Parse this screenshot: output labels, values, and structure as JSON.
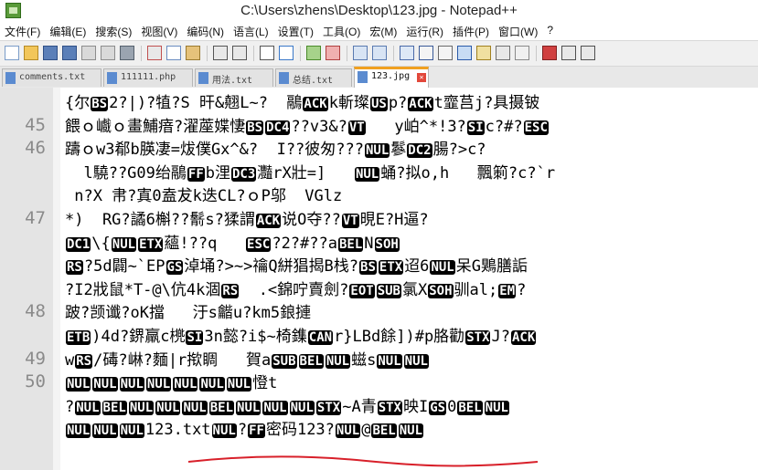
{
  "window": {
    "title": "C:\\Users\\zhens\\Desktop\\123.jpg - Notepad++"
  },
  "menu": {
    "items": [
      "文件(F)",
      "编辑(E)",
      "搜索(S)",
      "视图(V)",
      "编码(N)",
      "语言(L)",
      "设置(T)",
      "工具(O)",
      "宏(M)",
      "运行(R)",
      "插件(P)",
      "窗口(W)",
      "?"
    ]
  },
  "tabs": [
    {
      "label": "comments.txt"
    },
    {
      "label": "111111.php"
    },
    {
      "label": "用法.txt"
    },
    {
      "label": "总结.txt"
    },
    {
      "label": "123.jpg",
      "active": true
    }
  ],
  "editor": {
    "lines": [
      {
        "num": "",
        "segs": [
          [
            "t",
            "{尔"
          ],
          [
            "c",
            "BS"
          ],
          [
            "t",
            "2?|)?犆?S 旰&翹L~?  鷊"
          ],
          [
            "c",
            "ACK"
          ],
          [
            "t",
            "k斬璨"
          ],
          [
            "c",
            "US"
          ],
          [
            "t",
            "p?"
          ],
          [
            "c",
            "ACK"
          ],
          [
            "t",
            "t韲莒j?具摄铍"
          ]
        ]
      },
      {
        "num": "45",
        "segs": [
          [
            "t",
            "餵ｏ巇ｏ畫鯆瘖?濯蓙媟悽"
          ],
          [
            "c",
            "BS"
          ],
          [
            "c",
            "DC4"
          ],
          [
            "t",
            "??v3&?"
          ],
          [
            "c",
            "VT"
          ],
          [
            "t",
            "   y岶^*!3?"
          ],
          [
            "c",
            "SI"
          ],
          [
            "t",
            "c?#?"
          ],
          [
            "c",
            "ESC"
          ]
        ]
      },
      {
        "num": "46",
        "segs": [
          [
            "t",
            "躊ｏw3郩b朠凄=炦僕Gx^&?  I??彼匆???"
          ],
          [
            "c",
            "NUL"
          ],
          [
            "t",
            "鬖"
          ],
          [
            "c",
            "DC2"
          ],
          [
            "t",
            "腸?>c?"
          ]
        ]
      },
      {
        "num": "",
        "segs": [
          [
            "t",
            "  l驍??G09绐鷊"
          ],
          [
            "c",
            "FF"
          ],
          [
            "t",
            "b浬"
          ],
          [
            "c",
            "DC3"
          ],
          [
            "t",
            "灩rX壯=]   "
          ],
          [
            "c",
            "NUL"
          ],
          [
            "t",
            "蛹?拟o,h   飄箣?c?`r"
          ]
        ]
      },
      {
        "num": "",
        "segs": [
          [
            "t",
            " n?X 帇?寘0盍犮k迭CL?ｏP邬  VGlz"
          ]
        ]
      },
      {
        "num": "47",
        "segs": [
          [
            "t",
            "*)  RG?譎6槲??鬋s?猱謂"
          ],
          [
            "c",
            "ACK"
          ],
          [
            "t",
            "说O夺??"
          ],
          [
            "c",
            "VT"
          ],
          [
            "t",
            "晛E?H逼?"
          ]
        ]
      },
      {
        "num": "",
        "segs": [
          [
            "c",
            "DC1"
          ],
          [
            "t",
            "\\{"
          ],
          [
            "c",
            "NUL"
          ],
          [
            "c",
            "ETX"
          ],
          [
            "t",
            "蘊!??q   "
          ],
          [
            "c",
            "ESC"
          ],
          [
            "t",
            "?2?#??a"
          ],
          [
            "c",
            "BEL"
          ],
          [
            "t",
            "N"
          ],
          [
            "c",
            "SOH"
          ]
        ]
      },
      {
        "num": "",
        "segs": [
          [
            "c",
            "RS"
          ],
          [
            "t",
            "?5d闢~`EP"
          ],
          [
            "c",
            "GS"
          ],
          [
            "t",
            "淖埇?>~>禴Q絣猖揭B栈?"
          ],
          [
            "c",
            "BS"
          ],
          [
            "c",
            "ETX"
          ],
          [
            "t",
            "迢6"
          ],
          [
            "c",
            "NUL"
          ],
          [
            "t",
            "呆G鶪膳詬"
          ]
        ]
      },
      {
        "num": "",
        "segs": [
          [
            "t",
            "?I2戕鼠*T-@\\伉4k涸"
          ],
          [
            "c",
            "RS"
          ],
          [
            "t",
            "  .<錦咛賣劍?"
          ],
          [
            "c",
            "EOT"
          ],
          [
            "c",
            "SUB"
          ],
          [
            "t",
            "氯X"
          ],
          [
            "c",
            "SOH"
          ],
          [
            "t",
            "驯al;"
          ],
          [
            "c",
            "EM"
          ],
          [
            "t",
            "?"
          ]
        ]
      },
      {
        "num": "48",
        "segs": [
          [
            "t",
            "跛?𫖮谶?oK擋   汙s龤u?km5鋃摙"
          ]
        ]
      },
      {
        "num": "",
        "segs": [
          [
            "c",
            "ETB"
          ],
          [
            "t",
            ")4d?鎅羸c橷"
          ],
          [
            "c",
            "SI"
          ],
          [
            "t",
            "3n懿?i$~椅鏶"
          ],
          [
            "c",
            "CAN"
          ],
          [
            "t",
            "r}LBd餘])#p胳勸"
          ],
          [
            "c",
            "STX"
          ],
          [
            "t",
            "J?"
          ],
          [
            "c",
            "ACK"
          ]
        ]
      },
      {
        "num": "49",
        "segs": [
          [
            "t",
            "w"
          ],
          [
            "c",
            "RS"
          ],
          [
            "t",
            "/碡?崊?麵|r揿睭   賀a"
          ],
          [
            "c",
            "SUB"
          ],
          [
            "c",
            "BEL"
          ],
          [
            "c",
            "NUL"
          ],
          [
            "t",
            "螆s"
          ],
          [
            "c",
            "NUL"
          ],
          [
            "c",
            "NUL"
          ]
        ]
      },
      {
        "num": "50",
        "segs": [
          [
            "c",
            "NUL"
          ],
          [
            "c",
            "NUL"
          ],
          [
            "c",
            "NUL"
          ],
          [
            "c",
            "NUL"
          ],
          [
            "c",
            "NUL"
          ],
          [
            "c",
            "NUL"
          ],
          [
            "c",
            "NUL"
          ],
          [
            "t",
            "憕t"
          ]
        ]
      },
      {
        "num": "",
        "segs": [
          [
            "t",
            "?"
          ],
          [
            "c",
            "NUL"
          ],
          [
            "c",
            "BEL"
          ],
          [
            "c",
            "NUL"
          ],
          [
            "c",
            "NUL"
          ],
          [
            "c",
            "NUL"
          ],
          [
            "c",
            "BEL"
          ],
          [
            "c",
            "NUL"
          ],
          [
            "c",
            "NUL"
          ],
          [
            "c",
            "NUL"
          ],
          [
            "c",
            "STX"
          ],
          [
            "t",
            "~A青"
          ],
          [
            "c",
            "STX"
          ],
          [
            "t",
            "映I"
          ],
          [
            "c",
            "GS"
          ],
          [
            "t",
            "0"
          ],
          [
            "c",
            "BEL"
          ],
          [
            "c",
            "NUL"
          ]
        ]
      },
      {
        "num": "",
        "segs": [
          [
            "c",
            "NUL"
          ],
          [
            "c",
            "NUL"
          ],
          [
            "c",
            "NUL"
          ],
          [
            "t",
            "123.txt"
          ],
          [
            "c",
            "NUL"
          ],
          [
            "t",
            "?"
          ],
          [
            "c",
            "FF"
          ],
          [
            "t",
            "密码123?"
          ],
          [
            "c",
            "NUL"
          ],
          [
            "t",
            "@"
          ],
          [
            "c",
            "BEL"
          ],
          [
            "c",
            "NUL"
          ]
        ]
      }
    ]
  },
  "colors": {
    "annotation": "#d8202a",
    "control_char_bg": "#000000",
    "control_char_fg": "#ffffff",
    "gutter_bg": "#e4e4e4",
    "tab_active_accent": "#f0a020"
  }
}
